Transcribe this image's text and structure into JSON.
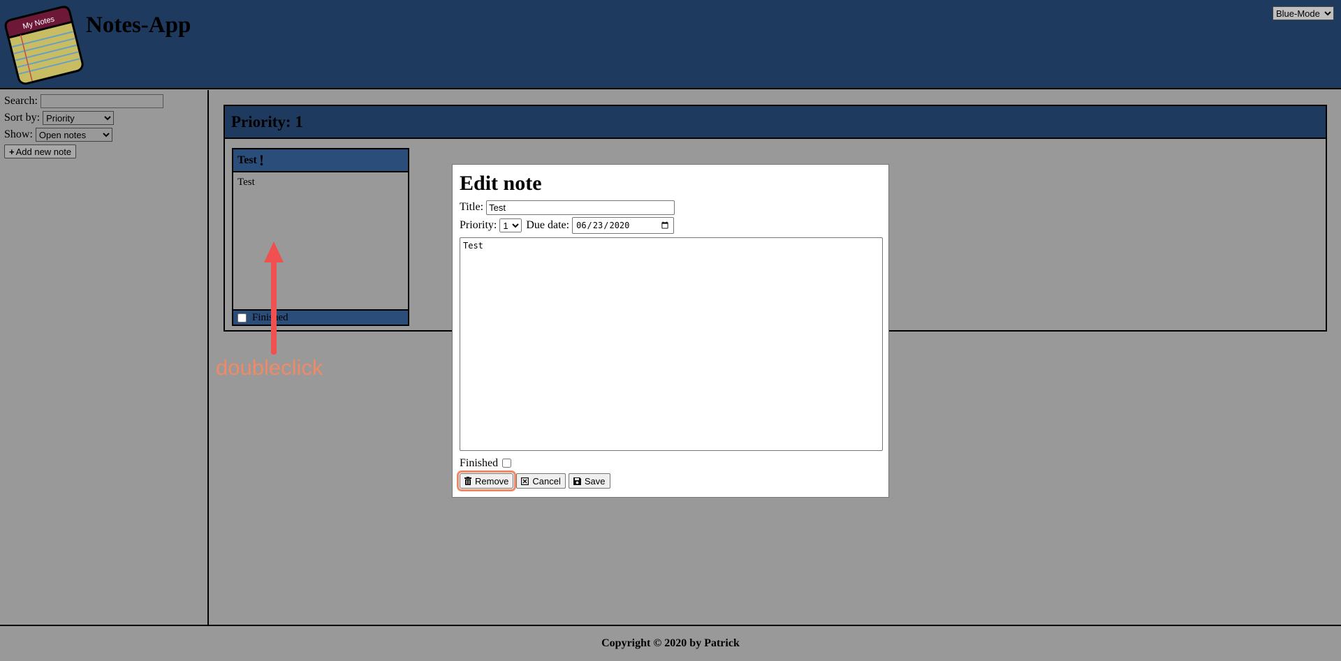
{
  "app": {
    "logo_text": "My Notes",
    "title": "Notes-App",
    "mode_select": {
      "selected": "Blue-Mode"
    }
  },
  "sidebar": {
    "search_label": "Search:",
    "search_value": "",
    "sort_label": "Sort by:",
    "sort_selected": "Priority",
    "show_label": "Show:",
    "show_selected": "Open notes",
    "add_button_label": "Add new note"
  },
  "main": {
    "group_title": "Priority: 1",
    "note_card": {
      "title": "Test",
      "priority_mark": "!",
      "body": "Test",
      "finished_label": "Finished",
      "finished": false
    }
  },
  "annotation": {
    "text": "doubleclick",
    "color": "#f08a66"
  },
  "modal": {
    "title": "Edit note",
    "title_label": "Title:",
    "title_value": "Test",
    "priority_label": "Priority:",
    "priority_selected": "1",
    "due_date_label": "Due date:",
    "due_date_value": "2020-06-23",
    "body_value": "Test",
    "finished_label": "Finished",
    "finished": false,
    "buttons": {
      "remove": "Remove",
      "cancel": "Cancel",
      "save": "Save"
    },
    "icons": {
      "remove": "trash-icon",
      "cancel": "close-box-icon",
      "save": "floppy-disk-icon"
    }
  },
  "footer": {
    "copyright": "Copyright © 2020 by Patrick"
  },
  "colors": {
    "header_bg": "#1e3a5f",
    "page_bg": "#999999",
    "card_header_bg": "#2a4d7a",
    "highlight": "#f08a66"
  }
}
